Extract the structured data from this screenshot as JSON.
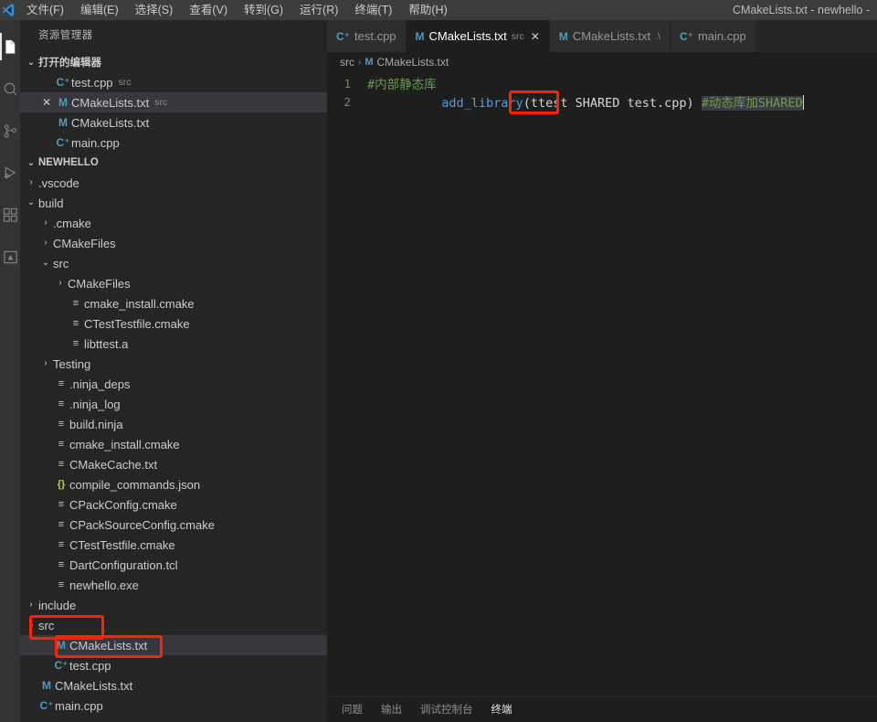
{
  "window": {
    "title": "CMakeLists.txt - newhello -"
  },
  "menu": {
    "items": [
      {
        "label": "文件(F)",
        "name": "menu-file"
      },
      {
        "label": "编辑(E)",
        "name": "menu-edit"
      },
      {
        "label": "选择(S)",
        "name": "menu-selection"
      },
      {
        "label": "查看(V)",
        "name": "menu-view"
      },
      {
        "label": "转到(G)",
        "name": "menu-go"
      },
      {
        "label": "运行(R)",
        "name": "menu-run"
      },
      {
        "label": "终端(T)",
        "name": "menu-terminal"
      },
      {
        "label": "帮助(H)",
        "name": "menu-help"
      }
    ]
  },
  "activitybar": {
    "items": [
      {
        "icon": "files-explorer-icon",
        "active": true
      },
      {
        "icon": "search-icon",
        "active": false
      },
      {
        "icon": "source-control-icon",
        "active": false
      },
      {
        "icon": "run-and-debug-icon",
        "active": false
      },
      {
        "icon": "extensions-icon",
        "active": false
      },
      {
        "icon": "testing-icon",
        "active": false
      }
    ]
  },
  "sidebar": {
    "title": "资源管理器",
    "open_editors": {
      "header": "打开的编辑器",
      "items": [
        {
          "name": "test.cpp",
          "desc": "src",
          "icon": "cpp",
          "selected": false,
          "close": false
        },
        {
          "name": "CMakeLists.txt",
          "desc": "src",
          "icon": "md",
          "selected": true,
          "close": true
        },
        {
          "name": "CMakeLists.txt",
          "desc": "",
          "icon": "md",
          "selected": false,
          "close": false
        },
        {
          "name": "main.cpp",
          "desc": "",
          "icon": "cpp",
          "selected": false,
          "close": false
        }
      ]
    },
    "project": {
      "header": "NEWHELLO",
      "items": [
        {
          "label": ".vscode",
          "kind": "folder",
          "open": false,
          "depth": 1
        },
        {
          "label": "build",
          "kind": "folder",
          "open": true,
          "depth": 1
        },
        {
          "label": ".cmake",
          "kind": "folder",
          "open": false,
          "depth": 2
        },
        {
          "label": "CMakeFiles",
          "kind": "folder",
          "open": false,
          "depth": 2
        },
        {
          "label": "src",
          "kind": "folder",
          "open": true,
          "depth": 2
        },
        {
          "label": "CMakeFiles",
          "kind": "folder",
          "open": false,
          "depth": 3
        },
        {
          "label": "cmake_install.cmake",
          "kind": "txtf",
          "depth": 3
        },
        {
          "label": "CTestTestfile.cmake",
          "kind": "txtf",
          "depth": 3
        },
        {
          "label": "libttest.a",
          "kind": "txtf",
          "depth": 3
        },
        {
          "label": "Testing",
          "kind": "folder",
          "open": false,
          "depth": 2
        },
        {
          "label": ".ninja_deps",
          "kind": "txtf",
          "depth": 2
        },
        {
          "label": ".ninja_log",
          "kind": "txtf",
          "depth": 2
        },
        {
          "label": "build.ninja",
          "kind": "txtf",
          "depth": 2
        },
        {
          "label": "cmake_install.cmake",
          "kind": "txtf",
          "depth": 2
        },
        {
          "label": "CMakeCache.txt",
          "kind": "txtf",
          "depth": 2
        },
        {
          "label": "compile_commands.json",
          "kind": "json",
          "depth": 2
        },
        {
          "label": "CPackConfig.cmake",
          "kind": "txtf",
          "depth": 2
        },
        {
          "label": "CPackSourceConfig.cmake",
          "kind": "txtf",
          "depth": 2
        },
        {
          "label": "CTestTestfile.cmake",
          "kind": "txtf",
          "depth": 2
        },
        {
          "label": "DartConfiguration.tcl",
          "kind": "txtf",
          "depth": 2
        },
        {
          "label": "newhello.exe",
          "kind": "txtf",
          "depth": 2
        },
        {
          "label": "include",
          "kind": "folder",
          "open": false,
          "depth": 1
        },
        {
          "label": "src",
          "kind": "folder",
          "open": true,
          "depth": 1,
          "annotated": true
        },
        {
          "label": "CMakeLists.txt",
          "kind": "md",
          "depth": 2,
          "selected": true,
          "annotated": true
        },
        {
          "label": "test.cpp",
          "kind": "cpp",
          "depth": 2
        },
        {
          "label": "CMakeLists.txt",
          "kind": "md",
          "depth": 1
        },
        {
          "label": "main.cpp",
          "kind": "cpp",
          "depth": 1
        }
      ]
    }
  },
  "tabs": [
    {
      "label": "test.cpp",
      "desc": "",
      "icon": "cpp",
      "active": false,
      "close": false
    },
    {
      "label": "CMakeLists.txt",
      "desc": "src",
      "icon": "md",
      "active": true,
      "close": true
    },
    {
      "label": "CMakeLists.txt",
      "desc": ".\\",
      "icon": "md",
      "active": false,
      "close": false
    },
    {
      "label": "main.cpp",
      "desc": "",
      "icon": "cpp",
      "active": false,
      "close": false
    }
  ],
  "breadcrumb": {
    "folder": "src",
    "separator": "›",
    "file": "CMakeLists.txt"
  },
  "editor_content": {
    "lines": [
      {
        "num": "1",
        "comment": "#内部静态库"
      },
      {
        "num": "2",
        "fn": "add_library",
        "args_before": "(ttest ",
        "boxed": "SHARED",
        "args_after": " test.cpp) ",
        "trailing_comment": "#动态库加SHARED"
      }
    ]
  },
  "panel": {
    "tabs": [
      {
        "label": "问题",
        "active": false
      },
      {
        "label": "输出",
        "active": false
      },
      {
        "label": "调试控制台",
        "active": false
      },
      {
        "label": "终端",
        "active": true
      }
    ]
  },
  "colors": {
    "accent_red": "#ff2200",
    "comment_green": "#6a9955",
    "keyword_blue": "#569cd6",
    "icon_blue": "#519aba",
    "json_yellow": "#cbcb41",
    "editor_bg": "#1e1e1e",
    "sidebar_bg": "#252526"
  }
}
